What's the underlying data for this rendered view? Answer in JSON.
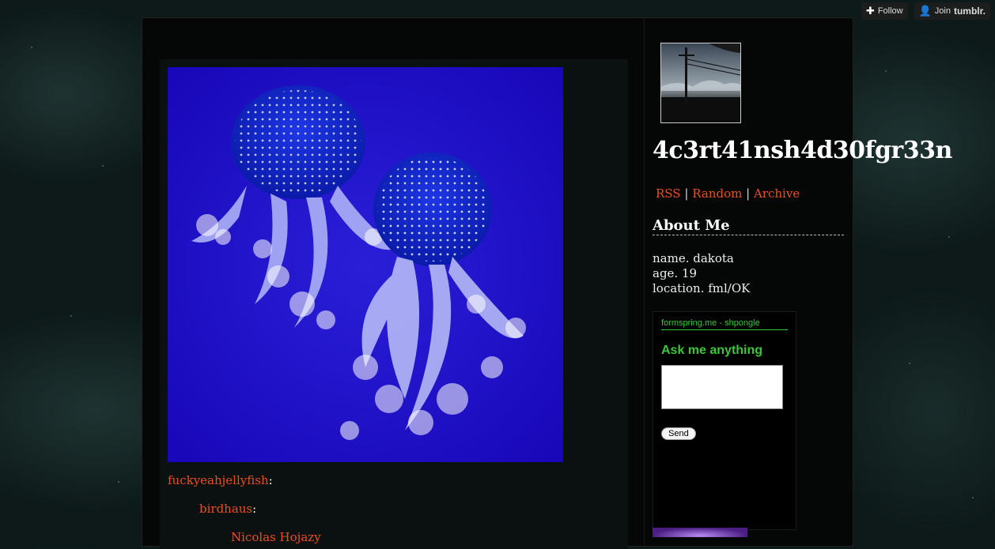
{
  "tumblr_controls": {
    "follow_label": "Follow",
    "join_label": "Join",
    "brand": "tumblr."
  },
  "post": {
    "sources": [
      {
        "name": "fuckyeahjellyfish",
        "suffix": ":"
      },
      {
        "name": "birdhaus",
        "suffix": ":"
      },
      {
        "name": "Nicolas Hojazy",
        "suffix": ""
      }
    ]
  },
  "sidebar": {
    "blog_title": "4c3rt41nsh4d30fgr33n",
    "nav": [
      "RSS",
      "Random",
      "Archive"
    ],
    "nav_separator": "|",
    "about_heading": "About Me",
    "about_lines": [
      "name. dakota",
      "age. 19",
      "location. fml/OK"
    ],
    "formspring": {
      "header": "formspring.me - shpongle",
      "ask_label": "Ask me anything",
      "send_label": "Send"
    }
  },
  "colors": {
    "link": "#e8511f",
    "formspring_green": "#37c837"
  }
}
